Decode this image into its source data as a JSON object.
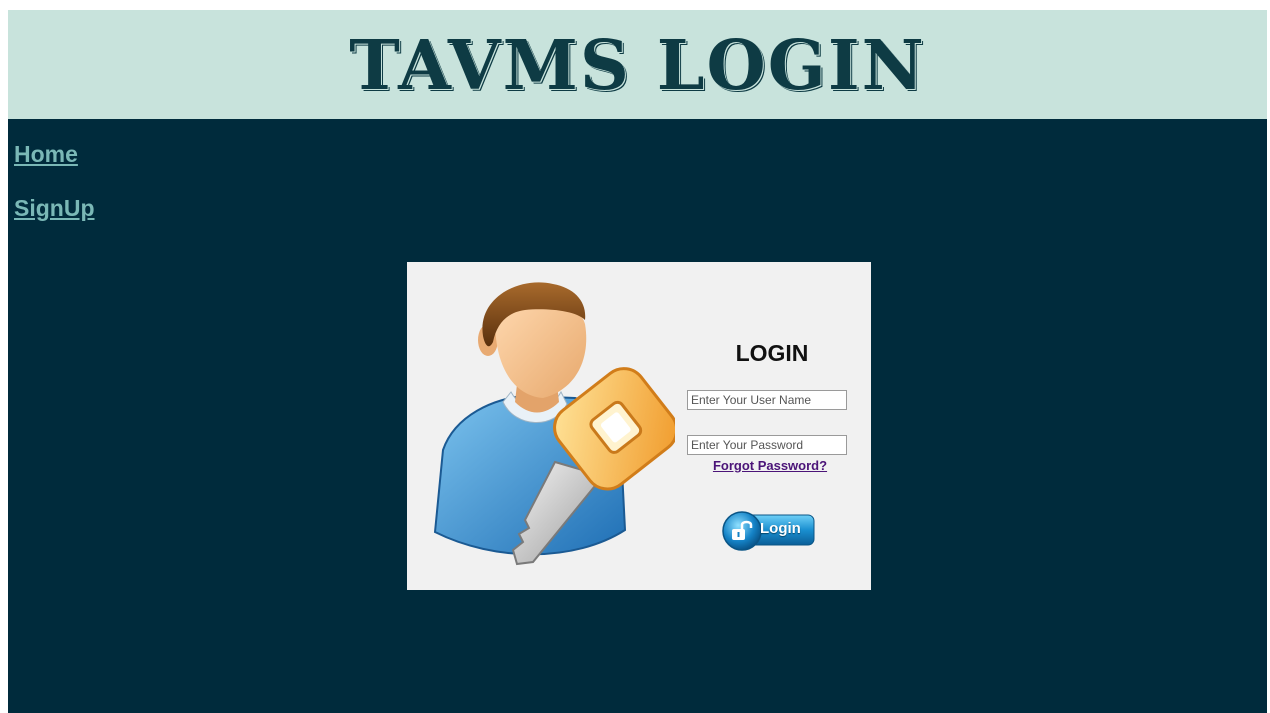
{
  "header": {
    "title": "TAVMS LOGIN"
  },
  "nav": {
    "home_label": "Home",
    "signup_label": "SignUp"
  },
  "login_form": {
    "heading": "LOGIN",
    "username_placeholder": "Enter Your User Name",
    "username_value": "",
    "password_placeholder": "Enter Your Password",
    "password_value": "",
    "forgot_label": "Forgot Password?",
    "submit_label": "Login"
  },
  "icons": {
    "illustration": "user-with-key-icon",
    "submit_icon": "unlock-padlock-icon"
  },
  "colors": {
    "header_bg": "#c8e3dc",
    "title_text": "#0e3b44",
    "page_bg": "#002b3c",
    "nav_link": "#7ab8b6",
    "login_panel_bg": "#f1f1f1",
    "forgot_link": "#4b1478",
    "button_blue": "#1a8fd0"
  }
}
